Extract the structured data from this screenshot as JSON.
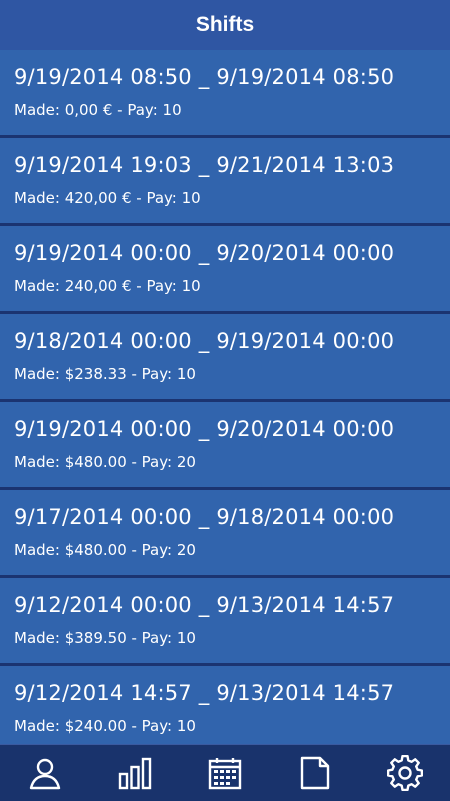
{
  "header": {
    "title": "Shifts"
  },
  "shifts": [
    {
      "range": "9/19/2014 08:50 _ 9/19/2014 08:50",
      "detail": "Made: 0,00 € - Pay: 10"
    },
    {
      "range": "9/19/2014 19:03 _ 9/21/2014 13:03",
      "detail": "Made: 420,00 € - Pay: 10"
    },
    {
      "range": "9/19/2014 00:00 _ 9/20/2014 00:00",
      "detail": "Made: 240,00 € - Pay: 10"
    },
    {
      "range": "9/18/2014 00:00 _ 9/19/2014 00:00",
      "detail": "Made: $238.33 - Pay: 10"
    },
    {
      "range": "9/19/2014 00:00 _ 9/20/2014 00:00",
      "detail": "Made: $480.00 - Pay: 20"
    },
    {
      "range": "9/17/2014 00:00 _ 9/18/2014 00:00",
      "detail": "Made: $480.00 - Pay: 20"
    },
    {
      "range": "9/12/2014 00:00 _ 9/13/2014 14:57",
      "detail": "Made: $389.50 - Pay: 10"
    },
    {
      "range": "9/12/2014 14:57 _ 9/13/2014 14:57",
      "detail": "Made: $240.00 - Pay: 10"
    }
  ],
  "bottom_nav": [
    {
      "icon": "person-icon"
    },
    {
      "icon": "bar-chart-icon"
    },
    {
      "icon": "calendar-icon"
    },
    {
      "icon": "document-icon"
    },
    {
      "icon": "gear-icon"
    }
  ],
  "colors": {
    "header_bg": "#2f56a3",
    "row_bg": "#3164ad",
    "divider": "#1b3471",
    "nav_bg": "#19336c",
    "text": "#ffffff"
  }
}
